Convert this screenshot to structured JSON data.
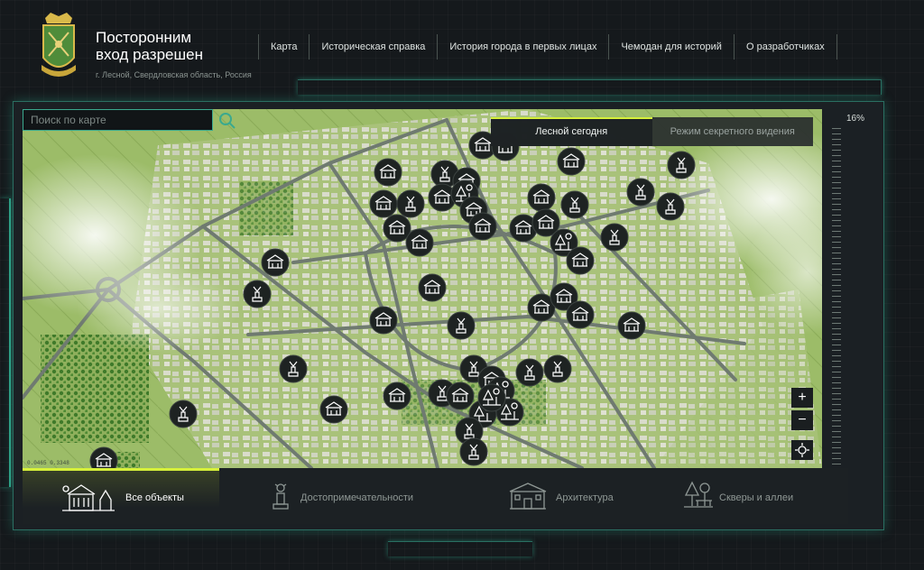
{
  "header": {
    "title": "Посторонним\nвход разрешен",
    "subtitle": "г. Лесной, Свердловская область, Россия"
  },
  "nav": [
    {
      "label": "Карта"
    },
    {
      "label": "Историческая справка"
    },
    {
      "label": "История города в первых лицах"
    },
    {
      "label": "Чемодан для историй"
    },
    {
      "label": "О разработчиках"
    }
  ],
  "search": {
    "placeholder": "Поиск по карте"
  },
  "modes": {
    "active": "Лесной сегодня",
    "other": "Режим секретного видения"
  },
  "zoom": {
    "level": "16%",
    "plus": "+",
    "minus": "−"
  },
  "coords": "0.0465   0.3348",
  "categories": [
    {
      "label": "Все объекты",
      "icon": "all-objects-icon"
    },
    {
      "label": "Достопримечательности",
      "icon": "monument-icon"
    },
    {
      "label": "Архитектура",
      "icon": "building-icon"
    },
    {
      "label": "Скверы и аллеи",
      "icon": "park-icon"
    }
  ],
  "colors": {
    "accent": "#d6f03a",
    "frame": "#2f9e86",
    "map_ground": "#9bb86a",
    "marker": "#1e2322"
  }
}
